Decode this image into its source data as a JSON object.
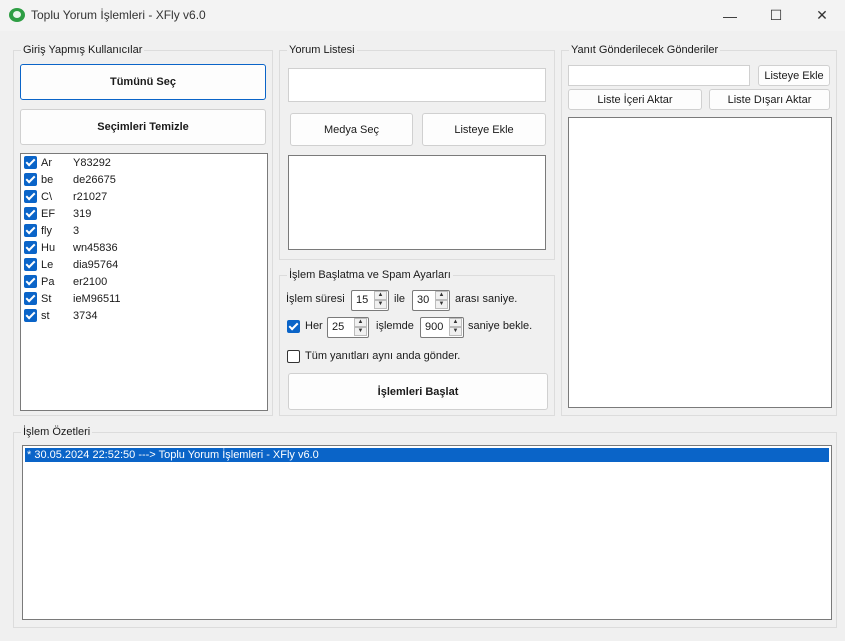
{
  "window": {
    "title": "Toplu Yorum İşlemleri - XFly v6.0",
    "minimize": "—",
    "maximize": "☐",
    "close": "✕"
  },
  "users_panel": {
    "legend": "Giriş Yapmış Kullanıcılar",
    "select_all": "Tümünü Seç",
    "clear_selection": "Seçimleri Temizle",
    "users": [
      {
        "a": "Ar",
        "b": "Y83292",
        "checked": true
      },
      {
        "a": "be",
        "b": "de26675",
        "checked": true
      },
      {
        "a": "C\\",
        "b": "r21027",
        "checked": true
      },
      {
        "a": "EF",
        "b": "319",
        "checked": true
      },
      {
        "a": "fly",
        "b": "3",
        "checked": true
      },
      {
        "a": "Hu",
        "b": "wn45836",
        "checked": true
      },
      {
        "a": "Le",
        "b": "dia95764",
        "checked": true
      },
      {
        "a": "Pa",
        "b": "er2100",
        "checked": true
      },
      {
        "a": "St",
        "b": "ieM96511",
        "checked": true
      },
      {
        "a": "st",
        "b": "3734",
        "checked": true
      }
    ]
  },
  "comments_panel": {
    "legend": "Yorum Listesi",
    "input_value": "",
    "media_select": "Medya Seç",
    "add_to_list": "Listeye Ekle"
  },
  "settings_panel": {
    "legend": "İşlem Başlatma ve Spam Ayarları",
    "duration_label": "İşlem süresi",
    "duration_from": "15",
    "and_label": "ile",
    "duration_to": "30",
    "seconds_between": "arası saniye.",
    "every_checked": true,
    "every_label": "Her",
    "every_count": "25",
    "per_action_label": "işlemde",
    "wait_seconds": "900",
    "wait_label": "saniye bekle.",
    "send_all_checked": false,
    "send_all_label": "Tüm yanıtları aynı anda gönder.",
    "start_button": "İşlemleri Başlat"
  },
  "posts_panel": {
    "legend": "Yanıt Gönderilecek Gönderiler",
    "input_value": "",
    "add_to_list": "Listeye Ekle",
    "import_list": "Liste İçeri Aktar",
    "export_list": "Liste Dışarı Aktar"
  },
  "log_panel": {
    "legend": "İşlem Özetleri",
    "entries": [
      "* 30.05.2024 22:52:50 ---> Toplu Yorum İşlemleri - XFly v6.0"
    ]
  },
  "colors": {
    "accent": "#0a64c8",
    "background": "#f0f0f0"
  }
}
